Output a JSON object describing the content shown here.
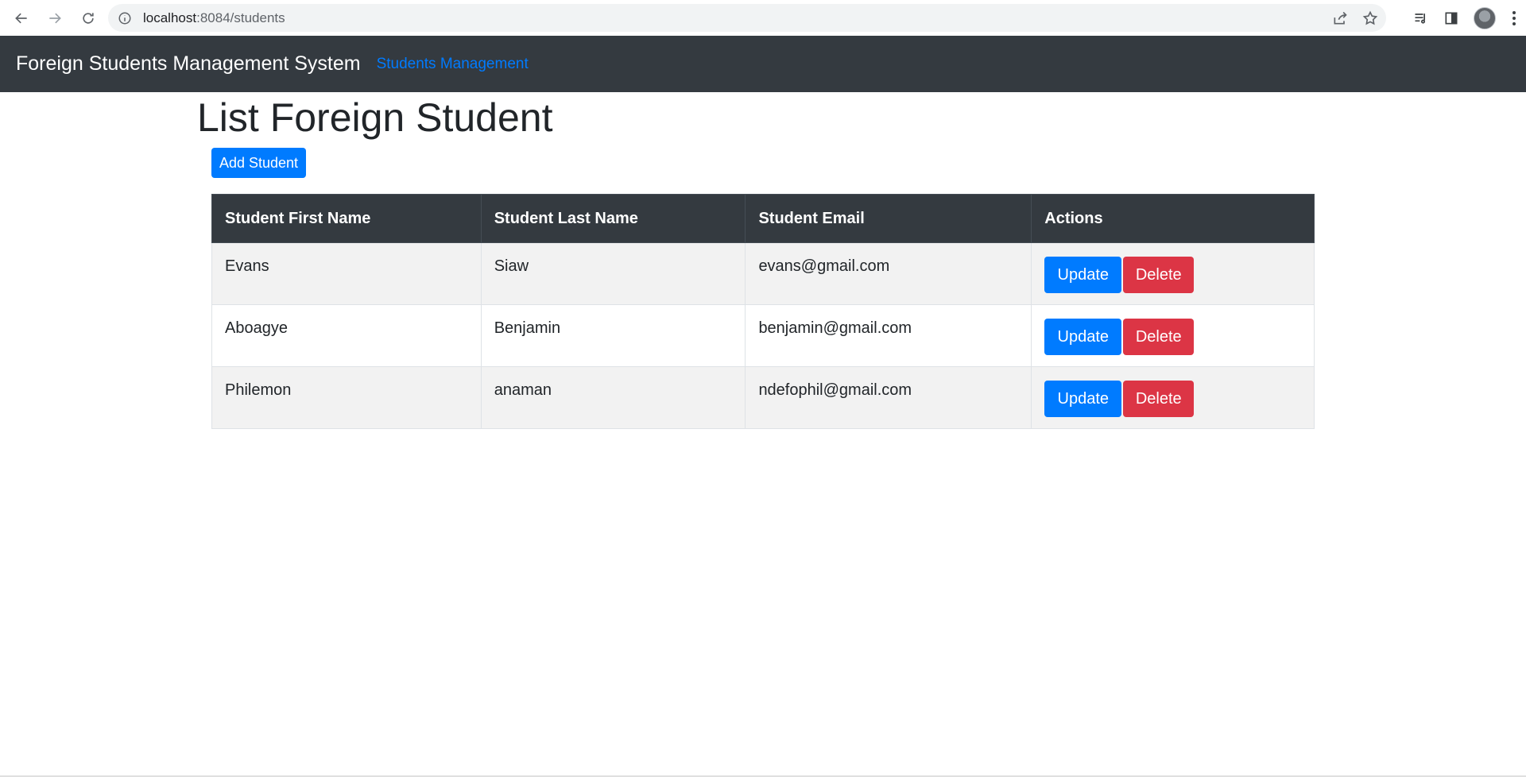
{
  "browser": {
    "url_host": "localhost",
    "url_path": ":8084/students",
    "icons": [
      "back-icon",
      "forward-icon",
      "reload-icon",
      "info-icon",
      "share-icon",
      "star-icon",
      "media-icon",
      "side-panel-icon",
      "avatar",
      "menu-icon"
    ]
  },
  "navbar": {
    "brand": "Foreign Students Management System",
    "link": "Students Management"
  },
  "page": {
    "title": "List Foreign Student",
    "add_button": "Add Student"
  },
  "table": {
    "headers": [
      "Student First Name",
      "Student Last Name",
      "Student Email",
      "Actions"
    ],
    "rows": [
      {
        "first": "Evans",
        "last": "Siaw",
        "email": "evans@gmail.com"
      },
      {
        "first": "Aboagye",
        "last": "Benjamin",
        "email": "benjamin@gmail.com"
      },
      {
        "first": "Philemon",
        "last": "anaman",
        "email": "ndefophil@gmail.com"
      }
    ],
    "update_label": "Update",
    "delete_label": "Delete"
  },
  "colors": {
    "navbar_bg": "#343a40",
    "primary": "#007bff",
    "danger": "#dc3545",
    "striped_row": "#f2f2f2"
  }
}
